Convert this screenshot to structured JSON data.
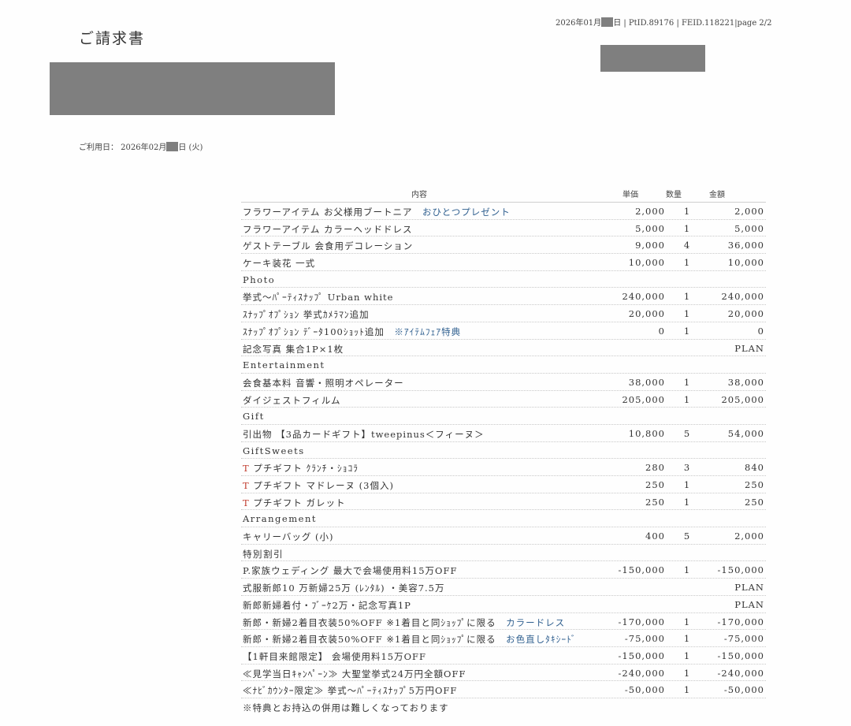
{
  "document": {
    "title": "ご請求書",
    "header_meta_prefix": "2026年01月",
    "header_meta_suffix": "日 | PtID.89176 | FEID.118221|page 2/2",
    "usage_prefix": "ご利用日： 2026年02月",
    "usage_suffix": "日 (火)"
  },
  "table": {
    "headers": {
      "description": "内容",
      "unit_price": "単価",
      "quantity": "数量",
      "amount": "金額"
    },
    "rows": [
      {
        "desc": "フラワーアイテム お父様用ブートニア",
        "note": "おひとつプレゼント",
        "price": "2,000",
        "qty": "1",
        "amount": "2,000"
      },
      {
        "desc": "フラワーアイテム カラーヘッドドレス",
        "price": "5,000",
        "qty": "1",
        "amount": "5,000"
      },
      {
        "desc": "ゲストテーブル 会食用デコレーション",
        "price": "9,000",
        "qty": "4",
        "amount": "36,000"
      },
      {
        "desc": "ケーキ装花 一式",
        "price": "10,000",
        "qty": "1",
        "amount": "10,000"
      },
      {
        "section": "Photo"
      },
      {
        "desc": "挙式〜ﾊﾟｰﾃｨｽﾅｯﾌﾟ Urban white",
        "price": "240,000",
        "qty": "1",
        "amount": "240,000"
      },
      {
        "desc": "ｽﾅｯﾌﾟｵﾌﾟｼｮﾝ 挙式ｶﾒﾗﾏﾝ追加",
        "price": "20,000",
        "qty": "1",
        "amount": "20,000"
      },
      {
        "desc": "ｽﾅｯﾌﾟｵﾌﾟｼｮﾝ ﾃﾞｰﾀ100ｼｮｯﾄ追加",
        "note": "※ｱｲﾃﾑﾌｪｱ特典",
        "price": "0",
        "qty": "1",
        "amount": "0"
      },
      {
        "desc": "記念写真 集合1P×1枚",
        "amount": "PLAN"
      },
      {
        "section": "Entertainment"
      },
      {
        "desc": "会食基本料 音響・照明オペレーター",
        "price": "38,000",
        "qty": "1",
        "amount": "38,000"
      },
      {
        "desc": "ダイジェストフィルム",
        "price": "205,000",
        "qty": "1",
        "amount": "205,000"
      },
      {
        "section": "Gift"
      },
      {
        "desc": "引出物 【3品カードギフト】tweepinus＜フィーヌ＞",
        "price": "10,800",
        "qty": "5",
        "amount": "54,000"
      },
      {
        "section": "GiftSweets"
      },
      {
        "mark": "T",
        "desc": "プチギフト ｸﾗﾝﾁ・ｼｮｺﾗ",
        "price": "280",
        "qty": "3",
        "amount": "840"
      },
      {
        "mark": "T",
        "desc": "プチギフト マドレーヌ (3個入)",
        "price": "250",
        "qty": "1",
        "amount": "250"
      },
      {
        "mark": "T",
        "desc": "プチギフト ガレット",
        "price": "250",
        "qty": "1",
        "amount": "250"
      },
      {
        "section": "Arrangement"
      },
      {
        "desc": "キャリーバッグ (小)",
        "price": "400",
        "qty": "5",
        "amount": "2,000"
      },
      {
        "section": "特別割引"
      },
      {
        "desc": "P.家族ウェディング 最大で会場使用料15万OFF",
        "price": "-150,000",
        "qty": "1",
        "amount": "-150,000"
      },
      {
        "desc": "式服新郎10 万新婦25万 (ﾚﾝﾀﾙ) ・美容7.5万",
        "amount": "PLAN"
      },
      {
        "desc": "新郎新婦着付・ﾌﾞｰｹ2万・記念写真1P",
        "amount": "PLAN"
      },
      {
        "desc": "新郎・新婦2着目衣装50%OFF ※1着目と同ｼｮｯﾌﾟに限る",
        "note": "カラードレス",
        "price": "-170,000",
        "qty": "1",
        "amount": "-170,000"
      },
      {
        "desc": "新郎・新婦2着目衣装50%OFF ※1着目と同ｼｮｯﾌﾟに限る",
        "note": "お色直しﾀｷｼｰﾄﾞ",
        "price": "-75,000",
        "qty": "1",
        "amount": "-75,000"
      },
      {
        "desc": "【1軒目来館限定】 会場使用料15万OFF",
        "price": "-150,000",
        "qty": "1",
        "amount": "-150,000"
      },
      {
        "desc": "≪見学当日ｷｬﾝﾍﾟｰﾝ≫ 大聖堂挙式24万円全額OFF",
        "price": "-240,000",
        "qty": "1",
        "amount": "-240,000"
      },
      {
        "desc": "≪ﾅﾋﾞｶｳﾝﾀｰ限定≫ 挙式〜ﾊﾟｰﾃｨｽﾅｯﾌﾟ5万円OFF",
        "price": "-50,000",
        "qty": "1",
        "amount": "-50,000"
      }
    ],
    "footer_note": "※特典とお持込の併用は難しくなっております"
  }
}
